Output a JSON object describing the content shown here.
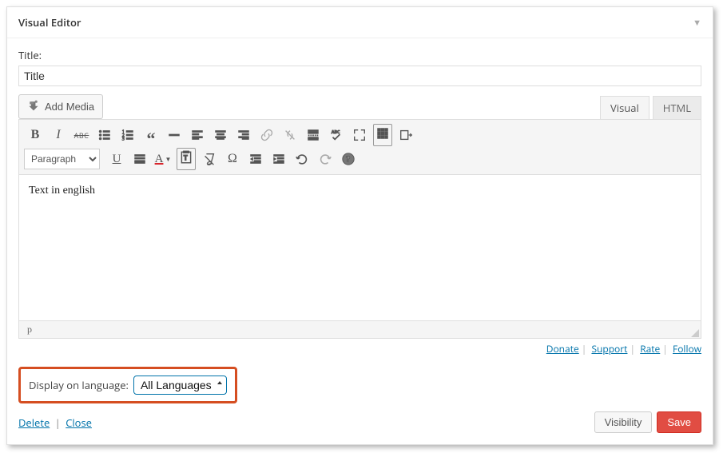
{
  "widget": {
    "title": "Visual Editor"
  },
  "field": {
    "title_label": "Title:",
    "title_value": "Title"
  },
  "media": {
    "add_label": "Add Media"
  },
  "tabs": {
    "visual": "Visual",
    "html": "HTML"
  },
  "toolbar": {
    "format_select": "Paragraph",
    "bold": "B",
    "italic": "I",
    "abc": "ABC",
    "underline": "U",
    "textcolor": "A"
  },
  "editor": {
    "content": "Text in english",
    "status_path": "p"
  },
  "footer": {
    "donate": "Donate",
    "support": "Support",
    "rate": "Rate",
    "follow": "Follow"
  },
  "language": {
    "label": "Display on language:",
    "selected": "All Languages"
  },
  "actions": {
    "delete": "Delete",
    "close": "Close",
    "visibility": "Visibility",
    "save": "Save"
  }
}
